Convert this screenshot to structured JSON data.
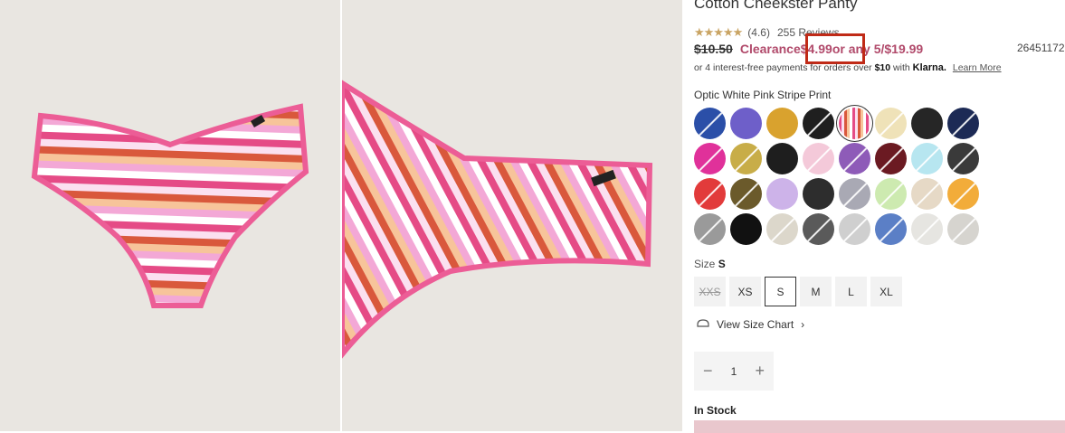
{
  "product": {
    "title": "Cotton Cheekster Panty",
    "rating": "(4.6)",
    "reviews": "255 Reviews",
    "old_price": "$10.50",
    "clearance_label": "Clearance ",
    "price": "$4.99",
    "offer_suffix": " or any 5/$19.99",
    "sku": "26451172",
    "klarna_prefix": "or 4 interest-free payments for orders over ",
    "klarna_amount": "$10",
    "klarna_with": " with ",
    "klarna_logo": "Klarna.",
    "klarna_learn": "Learn More"
  },
  "colors": {
    "label": "Optic White Pink Stripe Print",
    "swatches": [
      {
        "color": "#2b4fa8",
        "available": false
      },
      {
        "color": "#6e5fc9",
        "available": true
      },
      {
        "color": "#d9a22e",
        "available": true
      },
      {
        "color": "#1f1f1f",
        "available": false
      },
      {
        "color": "#f3b6c8",
        "available": true,
        "selected": true
      },
      {
        "color": "#efe2b8",
        "available": false
      },
      {
        "color": "#262626",
        "available": true
      },
      {
        "color": "#1c2a55",
        "available": false
      },
      {
        "color": "#e0319a",
        "available": false
      },
      {
        "color": "#c8ad48",
        "available": false
      },
      {
        "color": "#1e1e1e",
        "available": true
      },
      {
        "color": "#f4c9d9",
        "available": false
      },
      {
        "color": "#8e5bb8",
        "available": false
      },
      {
        "color": "#6b1a22",
        "available": false
      },
      {
        "color": "#b7e6f0",
        "available": false
      },
      {
        "color": "#3a3a3a",
        "available": false
      },
      {
        "color": "#e23b3b",
        "available": false
      },
      {
        "color": "#6b5a2b",
        "available": false
      },
      {
        "color": "#cdb3e9",
        "available": true
      },
      {
        "color": "#2d2d2d",
        "available": true
      },
      {
        "color": "#a9a9b4",
        "available": false
      },
      {
        "color": "#cdeab0",
        "available": false
      },
      {
        "color": "#e6d9c6",
        "available": false
      },
      {
        "color": "#f2ac3a",
        "available": false
      },
      {
        "color": "#9a9a9a",
        "available": false
      },
      {
        "color": "#111111",
        "available": true
      },
      {
        "color": "#dcd7cb",
        "available": false
      },
      {
        "color": "#5a5a5a",
        "available": false
      },
      {
        "color": "#cfcfcf",
        "available": false
      },
      {
        "color": "#5b7fc6",
        "available": false
      },
      {
        "color": "#e6e5e1",
        "available": false
      },
      {
        "color": "#d6d4cf",
        "available": false
      }
    ]
  },
  "size": {
    "label": "Size ",
    "selected": "S",
    "options": [
      {
        "label": "XXS",
        "available": false
      },
      {
        "label": "XS",
        "available": true
      },
      {
        "label": "S",
        "available": true,
        "selected": true
      },
      {
        "label": "M",
        "available": true
      },
      {
        "label": "L",
        "available": true
      },
      {
        "label": "XL",
        "available": true
      }
    ],
    "chart_link": "View Size Chart"
  },
  "quantity": {
    "value": "1",
    "minus": "−",
    "plus": "+"
  },
  "stock": "In Stock",
  "theme": {
    "accent": "#b14a6b",
    "highlight": "#c02a17",
    "cta": "#e9c7cd"
  }
}
